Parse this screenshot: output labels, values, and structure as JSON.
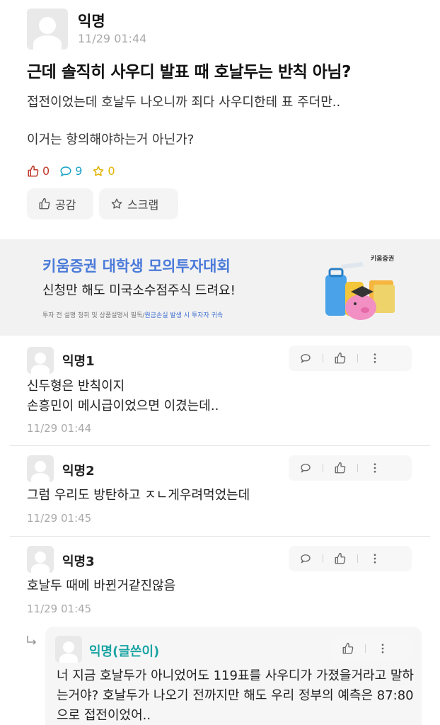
{
  "post": {
    "author": "익명",
    "time": "11/29 01:44",
    "title": "근데 솔직히 사우디 발표 때 호날두는 반칙 아님?",
    "body_line1": "접전이었는데 호날두 나오니까 죄다 사우디한테 표 주더만..",
    "body_line2": "이거는 항의해야하는거 아닌가?",
    "likes": "0",
    "comments": "9",
    "scraps": "0",
    "like_button": "공감",
    "scrap_button": "스크랩"
  },
  "ad": {
    "title": "키움증권 대학생 모의투자대회",
    "subtitle": "신청만 해도 미국소수점주식 드려요!",
    "note": "투자 전 설명 청취 및 상품설명서 필독/",
    "note_highlight": "원금손실 발생 시 투자자 귀속",
    "brand": "키움증권"
  },
  "comments": [
    {
      "author": "익명1",
      "lines": [
        "신두형은 반칙이지",
        "손흥민이 메시급이었으면 이겼는데.."
      ],
      "time": "11/29 01:44"
    },
    {
      "author": "익명2",
      "lines": [
        "그럼 우리도 방탄하고 ㅈㄴ게우려먹었는데"
      ],
      "time": "11/29 01:45"
    },
    {
      "author": "익명3",
      "lines": [
        "호날두 때메 바뀐거같진않음"
      ],
      "time": "11/29 01:45"
    }
  ],
  "reply": {
    "author": "익명(글쓴이)",
    "text": "너 지금 호날두가 아니었어도 119표를 사우디가 가졌을거라고 말하는거야? 호날두가 나오기 전까지만 해도 우리 정부의 예측은 87:80으로 접전이었어.."
  },
  "colors": {
    "like": "#c0392b",
    "comment": "#1aa3c7",
    "scrap": "#e1b300",
    "ad_title": "#4a7ad9",
    "op_author": "#1aa3a3"
  }
}
